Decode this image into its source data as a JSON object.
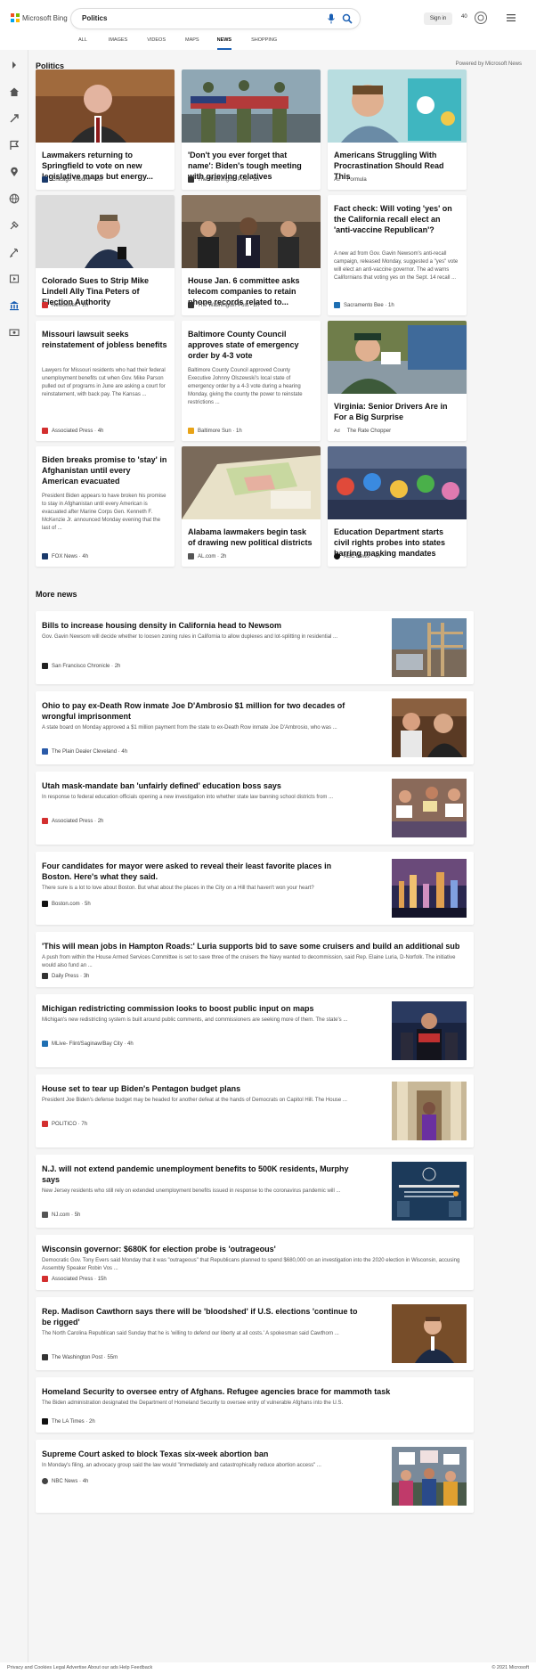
{
  "header": {
    "brand": "Microsoft Bing",
    "query": "Politics",
    "signin": "Sign in",
    "points": "40",
    "tabs": [
      "ALL",
      "IMAGES",
      "VIDEOS",
      "MAPS",
      "NEWS",
      "SHOPPING"
    ],
    "active_tab": "NEWS"
  },
  "section": {
    "title": "Politics",
    "powered": "Powered by Microsoft News"
  },
  "cards": [
    {
      "title": "Lawmakers returning to Springfield to vote on new legislative maps but energy...",
      "source": "Chicago Tribune",
      "time": "2m",
      "snippet": ""
    },
    {
      "title": "'Don't you ever forget that name': Biden's tough meeting with grieving relatives",
      "source": "The Washington Post",
      "time": "2h",
      "snippet": ""
    },
    {
      "title": "Americans Struggling With Procrastination Should Read This",
      "source": "Formula",
      "time": "",
      "ad": "Ad",
      "snippet": ""
    },
    {
      "title": "Colorado Sues to Strip Mike Lindell Ally Tina Peters of Election Authority",
      "source": "Newsweek",
      "time": "2h",
      "snippet": ""
    },
    {
      "title": "House Jan. 6 committee asks telecom companies to retain phone records related to...",
      "source": "The Washington Post",
      "time": "2h",
      "snippet": ""
    },
    {
      "title": "Fact check: Will voting 'yes' on the California recall elect an 'anti-vaccine Republican'?",
      "source": "Sacramento Bee",
      "time": "1h",
      "snippet": "A new ad from Gov. Gavin Newsom's anti-recall campaign, released Monday, suggested a \"yes\" vote will elect an anti-vaccine governor. The ad warns Californians that voting yes on the Sept. 14 recall ..."
    },
    {
      "title": "Missouri lawsuit seeks reinstatement of jobless benefits",
      "source": "Associated Press",
      "time": "4h",
      "snippet": "Lawyers for Missouri residents who had their federal unemployment benefits cut when Gov. Mike Parson pulled out of programs in June are asking a court for reinstatement, with back pay. The Kansas ..."
    },
    {
      "title": "Baltimore County Council approves state of emergency order by 4-3 vote",
      "source": "Baltimore Sun",
      "time": "1h",
      "snippet": "Baltimore County Council approved County Executive Johnny Olszewski's local state of emergency order by a 4-3 vote during a hearing Monday, giving the county the power to reinstate restrictions ..."
    },
    {
      "title": "Virginia: Senior Drivers Are in For a Big Surprise",
      "source": "The Rate Chopper",
      "time": "",
      "ad": "Ad",
      "snippet": ""
    },
    {
      "title": "Biden breaks promise to 'stay' in Afghanistan until every American evacuated",
      "source": "FOX News",
      "time": "4h",
      "snippet": "President Biden appears to have broken his promise to stay in Afghanistan until every American is evacuated after Marine Corps Gen. Kenneth F. McKenzie Jr. announced Monday evening that the last of ..."
    },
    {
      "title": "Alabama lawmakers begin task of drawing new political districts",
      "source": "AL.com",
      "time": "2h",
      "snippet": ""
    },
    {
      "title": "Education Department starts civil rights probes into states barring masking mandates",
      "source": "ABC News",
      "time": "4h",
      "snippet": ""
    }
  ],
  "more": {
    "title": "More news",
    "items": [
      {
        "title": "Bills to increase housing density in California head to Newsom",
        "snippet": "Gov. Gavin Newsom will decide whether to loosen zoning rules in California to allow duplexes and lot-splitting in residential ...",
        "source": "San Francisco Chronicle",
        "time": "2h"
      },
      {
        "title": "Ohio to pay ex-Death Row inmate Joe D'Ambrosio $1 million for two decades of wrongful imprisonment",
        "snippet": "A state board on Monday approved a $1 million payment from the state to ex-Death Row inmate Joe D'Ambrosio, who was ...",
        "source": "The Plain Dealer Cleveland",
        "time": "4h"
      },
      {
        "title": "Utah mask-mandate ban 'unfairly defined' education boss says",
        "snippet": "In response to federal education officials opening a new investigation into whether state law banning school districts from ...",
        "source": "Associated Press",
        "time": "2h"
      },
      {
        "title": "Four candidates for mayor were asked to reveal their least favorite places in Boston. Here's what they said.",
        "snippet": "There sure is a lot to love about Boston. But what about the places in the City on a Hill that haven't won your heart?",
        "source": "Boston.com",
        "time": "5h"
      },
      {
        "title": "'This will mean jobs in Hampton Roads:' Luria supports bid to save some cruisers and build an additional sub",
        "snippet": "A push from within the House Armed Services Committee is set to save three of the cruisers the Navy wanted to decommission, said Rep. Elaine Luria, D-Norfolk. The initiative would also fund an ...",
        "source": "Daily Press",
        "time": "3h"
      },
      {
        "title": "Michigan redistricting commission looks to boost public input on maps",
        "snippet": "Michigan's new redistricting system is built around public comments, and commissioners are seeking more of them. The state's ...",
        "source": "MLive- Flint/Saginaw/Bay City",
        "time": "4h"
      },
      {
        "title": "House set to tear up Biden's Pentagon budget plans",
        "snippet": "President Joe Biden's defense budget may be headed for another defeat at the hands of Democrats on Capitol Hill. The House ...",
        "source": "POLITICO",
        "time": "7h"
      },
      {
        "title": "N.J. will not extend pandemic unemployment benefits to 500K residents, Murphy says",
        "snippet": "New Jersey residents who still rely on extended unemployment benefits issued in response to the coronavirus pandemic will ...",
        "source": "NJ.com",
        "time": "5h"
      },
      {
        "title": "Wisconsin governor: $680K for election probe is 'outrageous'",
        "snippet": "Democratic Gov. Tony Evers said Monday that it was \"outrageous\" that Republicans planned to spend $680,000 on an investigation into the 2020 election in Wisconsin, accusing Assembly Speaker Robin Vos ...",
        "source": "Associated Press",
        "time": "15h"
      },
      {
        "title": "Rep. Madison Cawthorn says there will be 'bloodshed' if U.S. elections 'continue to be rigged'",
        "snippet": "The North Carolina Republican said Sunday that he is 'willing to defend our liberty at all costs.' A spokesman said Cawthorn ...",
        "source": "The Washington Post",
        "time": "55m"
      },
      {
        "title": "Homeland Security to oversee entry of Afghans. Refugee agencies brace for mammoth task",
        "snippet": "The Biden administration designated the Department of Homeland Security to oversee entry of vulnerable Afghans into the U.S.",
        "source": "The LA Times",
        "time": "2h"
      },
      {
        "title": "Supreme Court asked to block Texas six-week abortion ban",
        "snippet": "In Monday's filing, an advocacy group said the law would \"immediately and catastrophically reduce abortion access\" ...",
        "source": "NBC News",
        "time": "4h"
      }
    ]
  },
  "footer": {
    "left": "Privacy and Cookies   Legal   Advertise   About our ads   Help   Feedback",
    "right": "© 2021 Microsoft"
  },
  "colors": {
    "accent": "#1a5fb4",
    "logo_red": "#f25022",
    "logo_green": "#7fba00",
    "logo_blue": "#00a4ef",
    "logo_yellow": "#ffb900"
  }
}
